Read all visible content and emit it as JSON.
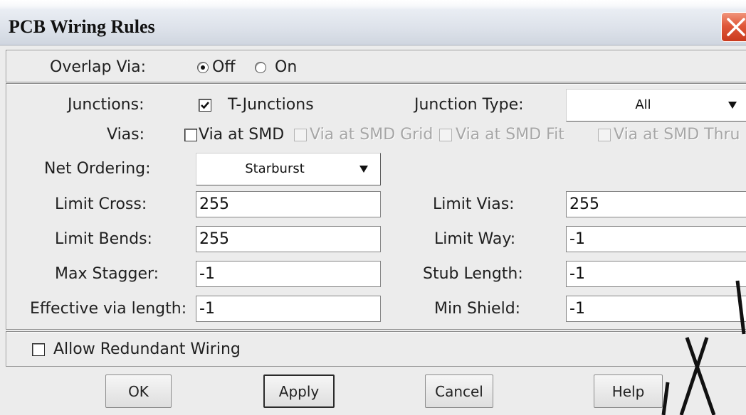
{
  "window": {
    "title": "PCB Wiring Rules",
    "close_icon": "close-icon"
  },
  "overlap_via": {
    "label": "Overlap Via:",
    "options": [
      {
        "label": "Off",
        "selected": true
      },
      {
        "label": "On",
        "selected": false
      }
    ]
  },
  "junctions": {
    "label": "Junctions:",
    "t_junctions": {
      "label": "T-Junctions",
      "checked": true
    },
    "junction_type": {
      "label": "Junction Type:",
      "value": "All",
      "icon": "dropdown-arrow-icon"
    }
  },
  "vias": {
    "label": "Vias:",
    "options": [
      {
        "label": "Via at SMD",
        "checked": false,
        "enabled": true
      },
      {
        "label": "Via at SMD Grid",
        "checked": false,
        "enabled": false
      },
      {
        "label": "Via at SMD Fit",
        "checked": false,
        "enabled": false
      },
      {
        "label": "Via at SMD Thru",
        "checked": false,
        "enabled": false
      }
    ]
  },
  "net_ordering": {
    "label": "Net Ordering:",
    "value": "Starburst",
    "icon": "dropdown-arrow-icon"
  },
  "fields": {
    "limit_cross": {
      "label": "Limit Cross:",
      "value": "255"
    },
    "limit_vias": {
      "label": "Limit Vias:",
      "value": "255"
    },
    "limit_bends": {
      "label": "Limit Bends:",
      "value": "255"
    },
    "limit_way": {
      "label": "Limit Way:",
      "value": "-1"
    },
    "max_stagger": {
      "label": "Max Stagger:",
      "value": "-1"
    },
    "stub_length": {
      "label": "Stub Length:",
      "value": "-1"
    },
    "effective_via_length": {
      "label": "Effective via length:",
      "value": "-1"
    },
    "min_shield": {
      "label": "Min Shield:",
      "value": "-1"
    }
  },
  "allow_redundant_wiring": {
    "label": "Allow Redundant Wiring",
    "checked": false
  },
  "buttons": {
    "ok": {
      "label": "OK",
      "focused": false
    },
    "apply": {
      "label": "Apply",
      "focused": true
    },
    "cancel": {
      "label": "Cancel",
      "focused": false
    },
    "help": {
      "label": "Help",
      "focused": false
    }
  },
  "icons": {
    "checkbox_checked": "checkmark-icon"
  },
  "colors": {
    "dialog_background": "#ececec",
    "title_bar": "#dde2ea",
    "close_button": "#e0583a",
    "disabled_text": "#a6a6a6"
  }
}
